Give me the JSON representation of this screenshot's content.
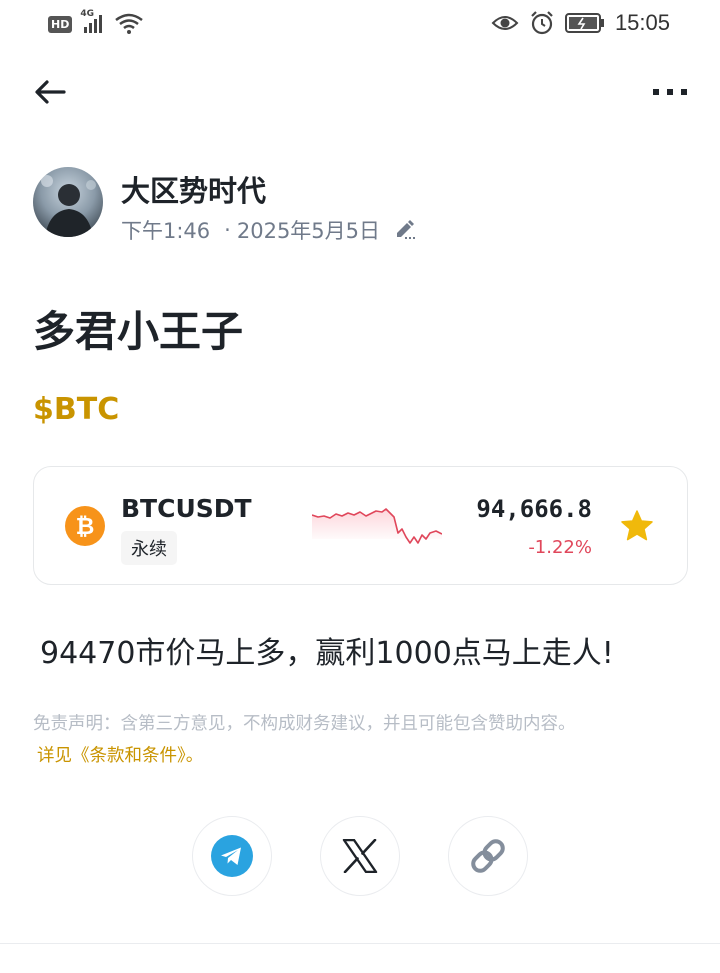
{
  "status_bar": {
    "network_badge": "HD",
    "network_type": "4G",
    "time": "15:05"
  },
  "post": {
    "author_name": "大区势时代",
    "time": "下午1:46",
    "separator": "·",
    "date": "2025年5月5日",
    "title": "多君小王子",
    "tag": "$BTC",
    "body": "94470市价马上多，赢利1000点马上走人!"
  },
  "ticker": {
    "coin_icon": "bitcoin-icon",
    "pair": "BTCUSDT",
    "type": "永续",
    "price": "94,666.8",
    "change": "-1.22%",
    "change_color": "#e0475b",
    "favorited": true
  },
  "disclaimer": {
    "text": "免责声明：含第三方意见，不构成财务建议，并且可能包含赞助内容。",
    "link_text": "详见《条款和条件》。"
  },
  "share": {
    "buttons": [
      "telegram-icon",
      "x-icon",
      "link-icon"
    ]
  },
  "colors": {
    "accent": "#c99400",
    "text": "#1e2329",
    "muted": "#707a8a",
    "negative": "#e0475b",
    "star": "#f0b90b"
  }
}
